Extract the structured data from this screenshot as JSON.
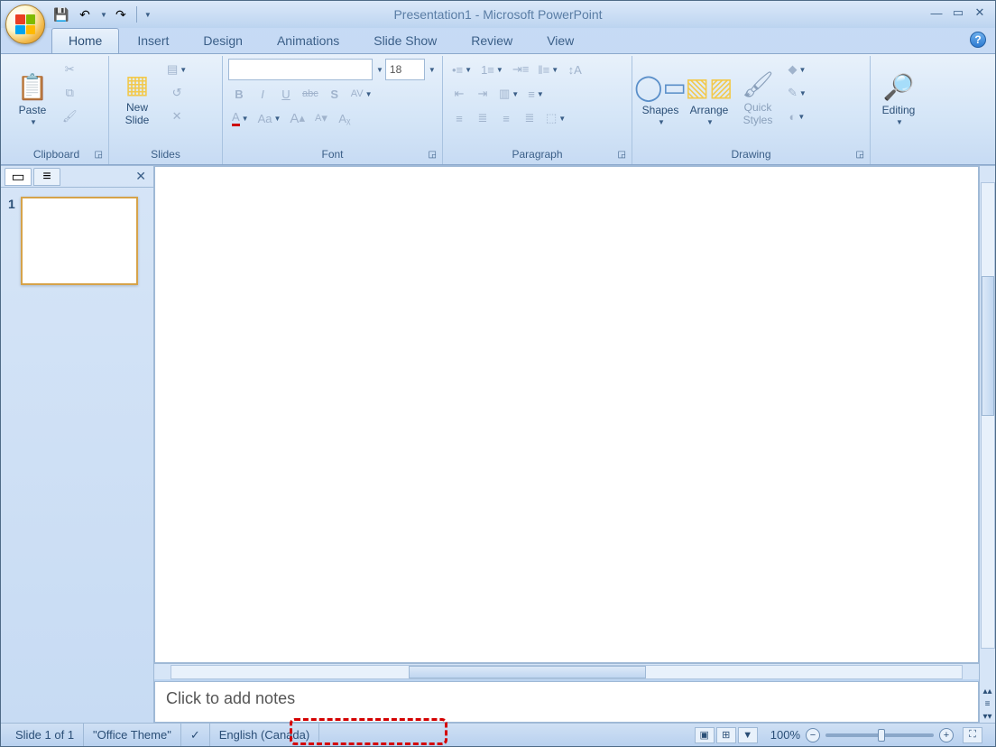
{
  "title": "Presentation1 - Microsoft PowerPoint",
  "qat": {
    "save": "💾",
    "undo": "↶",
    "redo": "↷"
  },
  "tabs": [
    "Home",
    "Insert",
    "Design",
    "Animations",
    "Slide Show",
    "Review",
    "View"
  ],
  "active_tab": 0,
  "ribbon": {
    "clipboard": {
      "label": "Clipboard",
      "paste": "Paste"
    },
    "slides": {
      "label": "Slides",
      "new_slide": "New\nSlide"
    },
    "font": {
      "label": "Font",
      "font_name": "",
      "font_size": "18",
      "bold": "B",
      "italic": "I",
      "underline": "U",
      "strike": "abc",
      "shadow": "S",
      "spacing": "AV",
      "font_color": "A",
      "case": "Aa",
      "grow": "A",
      "shrink": "A",
      "clear": "⌫"
    },
    "paragraph": {
      "label": "Paragraph"
    },
    "drawing": {
      "label": "Drawing",
      "shapes": "Shapes",
      "arrange": "Arrange",
      "styles": "Quick\nStyles"
    },
    "editing": {
      "label": "Editing",
      "btn": "Editing"
    }
  },
  "slidepanel": {
    "slide_number": "1"
  },
  "notes_placeholder": "Click to add notes",
  "status": {
    "slide_of": "Slide 1 of 1",
    "theme": "\"Office Theme\"",
    "spell_icon": "✓",
    "language": "English (Canada)",
    "zoom": "100%"
  }
}
